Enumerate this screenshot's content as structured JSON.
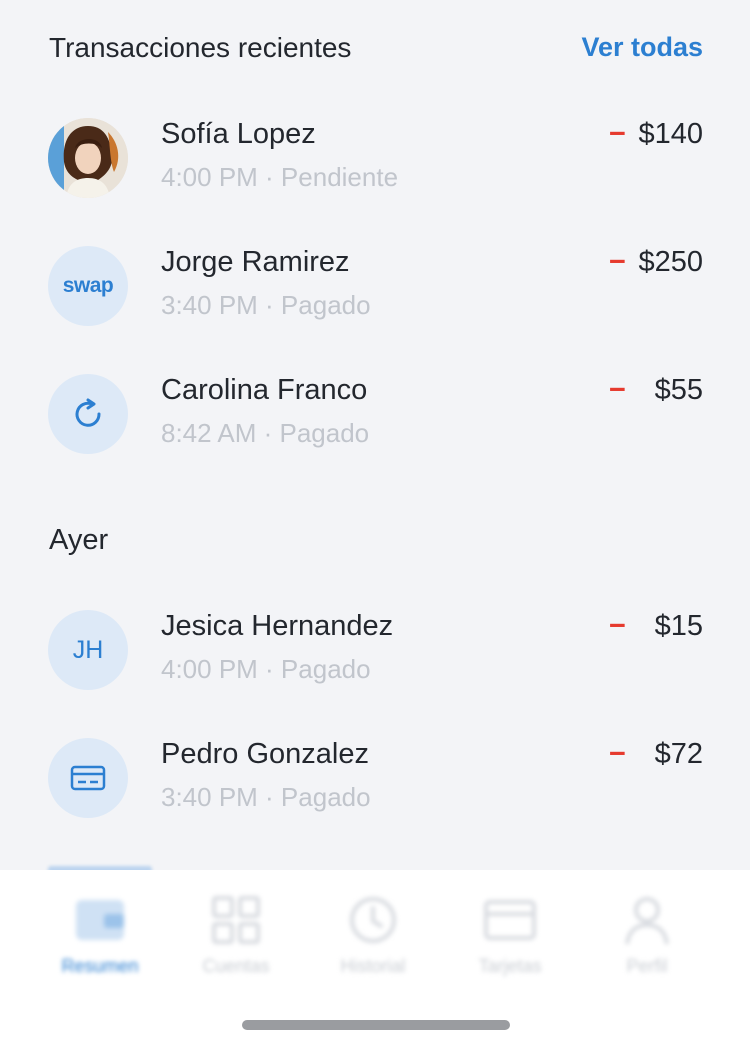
{
  "header": {
    "title": "Transacciones recientes",
    "see_all": "Ver todas"
  },
  "today": [
    {
      "name": "Sofía Lopez",
      "meta": "4:00 PM · Pendiente",
      "sign": "−",
      "amount": "$140",
      "avatar": "photo"
    },
    {
      "name": "Jorge Ramirez",
      "meta": "3:40 PM · Pagado",
      "sign": "−",
      "amount": "$250",
      "avatar": "swap"
    },
    {
      "name": "Carolina Franco",
      "meta": "8:42 AM · Pagado",
      "sign": "−",
      "amount": "$55",
      "avatar": "refresh-icon"
    }
  ],
  "yesterday_label": "Ayer",
  "yesterday": [
    {
      "name": "Jesica Hernandez",
      "meta": "4:00 PM · Pagado",
      "sign": "−",
      "amount": "$15",
      "avatar": "JH"
    },
    {
      "name": "Pedro Gonzalez",
      "meta": "3:40 PM · Pagado",
      "sign": "−",
      "amount": "$72",
      "avatar": "card-icon"
    }
  ],
  "avatar_text": {
    "swap": "swap",
    "initials": "JH"
  },
  "tabs": [
    {
      "label": "Resumen",
      "icon": "wallet-icon",
      "active": true
    },
    {
      "label": "Cuentas",
      "icon": "grid-icon",
      "active": false
    },
    {
      "label": "Historial",
      "icon": "clock-icon",
      "active": false
    },
    {
      "label": "Tarjetas",
      "icon": "card-icon",
      "active": false
    },
    {
      "label": "Perfil",
      "icon": "user-icon",
      "active": false
    }
  ],
  "colors": {
    "accent": "#2c7fd1",
    "negative": "#e63a2e",
    "background": "#f3f4f7",
    "text": "#23272e",
    "muted": "#c1c5cc"
  }
}
